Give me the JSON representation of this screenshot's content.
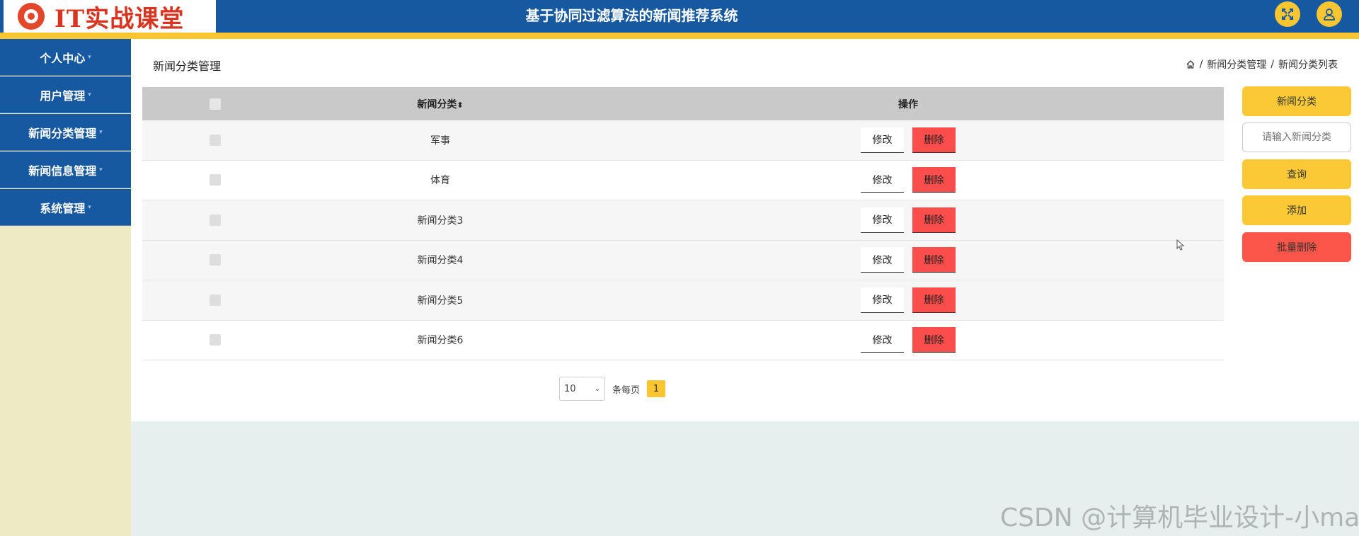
{
  "app": {
    "logo_text": "IT实战课堂",
    "title": "基于协同过滤算法的新闻推荐系统"
  },
  "sidebar": {
    "items": [
      {
        "label": "个人中心"
      },
      {
        "label": "用户管理"
      },
      {
        "label": "新闻分类管理"
      },
      {
        "label": "新闻信息管理"
      },
      {
        "label": "系统管理"
      }
    ]
  },
  "page": {
    "title": "新闻分类管理",
    "breadcrumb": [
      "新闻分类管理",
      "新闻分类列表"
    ],
    "breadcrumb_sep": "/"
  },
  "table": {
    "headers": {
      "category": "新闻分类",
      "sort_icon": "⬍",
      "actions": "操作"
    },
    "rows": [
      {
        "category": "军事"
      },
      {
        "category": "体育"
      },
      {
        "category": "新闻分类3"
      },
      {
        "category": "新闻分类4"
      },
      {
        "category": "新闻分类5"
      },
      {
        "category": "新闻分类6"
      }
    ],
    "edit_label": "修改",
    "delete_label": "删除"
  },
  "pagination": {
    "page_size": "10",
    "per_page_label": "条每页",
    "current_page": "1"
  },
  "actions": {
    "category_label": "新闻分类",
    "search_placeholder": "请输入新闻分类",
    "query_label": "查询",
    "add_label": "添加",
    "batch_delete_label": "批量删除"
  },
  "watermark": "CSDN @计算机毕业设计-小ma",
  "colors": {
    "header_blue": "#1759a0",
    "accent_yellow": "#f9c631",
    "danger_red": "#fb4d4b",
    "sidebar_bg": "#eeeac4"
  }
}
